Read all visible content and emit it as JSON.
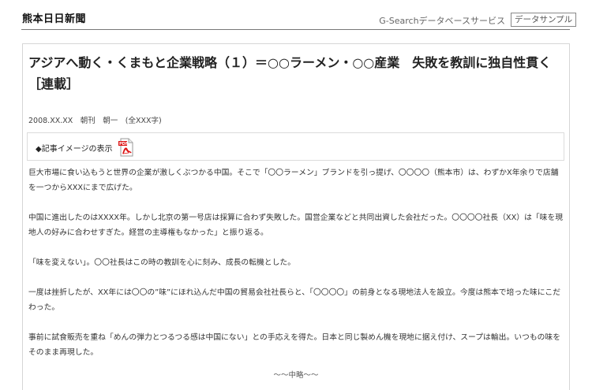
{
  "header": {
    "paper_name": "熊本日日新聞",
    "service_name": "G-Searchデータベースサービス",
    "sample_label": "データサンプル"
  },
  "article": {
    "title": "アジアへ動く・くまもと企業戦略（１）＝○○ラーメン・○○産業　失敗を教訓に独自性貫く　［連載］",
    "meta": "2008.XX.XX　朝刊　朝一　(全XXX字)",
    "image_link_label": "◆記事イメージの表示",
    "paragraphs": [
      "巨大市場に食い込もうと世界の企業が激しくぶつかる中国。そこで「〇〇ラーメン」ブランドを引っ提げ、〇〇〇〇（熊本市）は、わずかX年余りで店舗を一つからXXXにまで広げた。",
      "中国に進出したのはXXXX年。しかし北京の第一号店は採算に合わず失敗した。国営企業などと共同出資した会社だった。〇〇〇〇社長（XX）は「味を現地人の好みに合わせすぎた。経営の主導権もなかった」と振り返る。",
      "「味を変えない」。〇〇社長はこの時の教訓を心に刻み、成長の転機とした。",
      "一度は挫折したが、XX年には〇〇の”味”にほれ込んだ中国の貿易会社社長らと、「〇〇〇〇」の前身となる現地法人を設立。今度は熊本で培った味にこだわった。",
      "事前に試食販売を重ね「めんの弾力とつるつる感は中国にない」との手応えを得た。日本と同じ製めん機を現地に据え付け、スープは輸出。いつもの味をそのまま再現した。"
    ],
    "omitted_marker": "〜〜中略〜〜"
  }
}
